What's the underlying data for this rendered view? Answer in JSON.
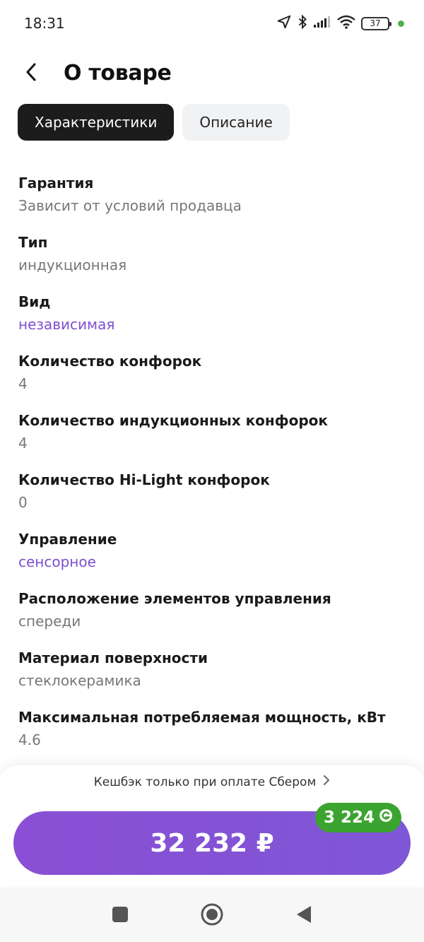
{
  "status_bar": {
    "time": "18:31",
    "battery": "37",
    "icons": [
      "navigation-icon",
      "bluetooth-icon",
      "signal-icon",
      "wifi-icon",
      "battery-icon"
    ]
  },
  "header": {
    "title": "О товаре"
  },
  "tabs": [
    {
      "label": "Характеристики",
      "active": true
    },
    {
      "label": "Описание",
      "active": false
    }
  ],
  "specs": [
    {
      "name": "Гарантия",
      "value": "Зависит от условий продавца",
      "link": false
    },
    {
      "name": "Тип",
      "value": "индукционная",
      "link": false
    },
    {
      "name": "Вид",
      "value": "независимая",
      "link": true
    },
    {
      "name": "Количество конфорок",
      "value": "4",
      "link": false
    },
    {
      "name": "Количество индукционных конфорок",
      "value": "4",
      "link": false
    },
    {
      "name": "Количество Hi-Light конфорок",
      "value": "0",
      "link": false
    },
    {
      "name": "Управление",
      "value": "сенсорное",
      "link": true
    },
    {
      "name": "Расположение элементов управления",
      "value": "спереди",
      "link": false
    },
    {
      "name": "Материал поверхности",
      "value": "стеклокерамика",
      "link": false
    },
    {
      "name": "Максимальная потребляемая мощность, кВт",
      "value": "4.6",
      "link": false
    }
  ],
  "purchase": {
    "cashback_note": "Кешбэк только при оплате Сбером",
    "price": "32 232 ₽",
    "bonus": "3 224"
  },
  "colors": {
    "accent": "#7d4fd1",
    "button": "#8a4fd4",
    "bonus_badge": "#3ba32f",
    "tab_active": "#1c1c1c",
    "tab_inactive": "#f1f2f4"
  }
}
